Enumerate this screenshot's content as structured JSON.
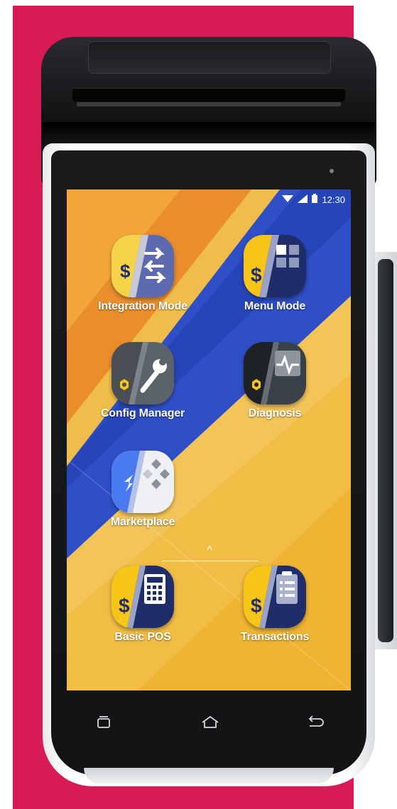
{
  "status_bar": {
    "time": "12:30",
    "icons": [
      "wifi-icon",
      "signal-icon",
      "battery-icon"
    ]
  },
  "apps": [
    {
      "label": "Integration Mode",
      "icon": "integration-mode-icon"
    },
    {
      "label": "Menu Mode",
      "icon": "menu-mode-icon"
    },
    {
      "label": "Config Manager",
      "icon": "config-manager-icon"
    },
    {
      "label": "Diagnosis",
      "icon": "diagnosis-icon"
    },
    {
      "label": "Marketplace",
      "icon": "marketplace-icon"
    }
  ],
  "dock": [
    {
      "label": "Basic POS",
      "icon": "basic-pos-icon"
    },
    {
      "label": "Transactions",
      "icon": "transactions-icon"
    }
  ],
  "drawer_handle": "^",
  "nav": [
    "recent-apps-icon",
    "home-icon",
    "back-icon"
  ],
  "colors": {
    "background": "#d81b55",
    "wallpaper": "#efb63a",
    "brand_yellow": "#f5c518",
    "brand_navy": "#1f2d6b"
  }
}
